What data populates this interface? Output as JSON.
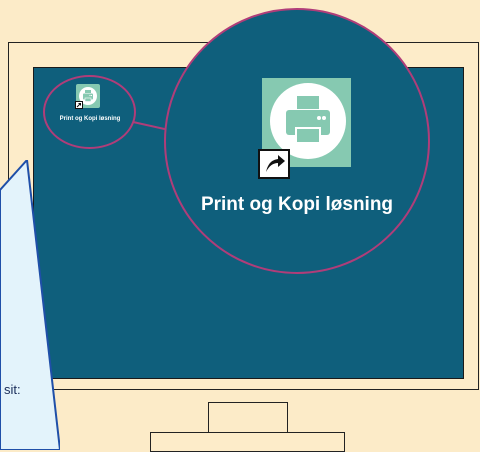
{
  "desktop": {
    "shortcut_label": "Print og Kopi løsning",
    "icon": "printer-shortcut-icon"
  },
  "zoom": {
    "label": "Print og Kopi løsning",
    "icon": "printer-shortcut-icon"
  },
  "callout": {
    "partial_text": "sit:"
  },
  "colors": {
    "background": "#fcebc8",
    "screen": "#0f5f7c",
    "icon_tile": "#86c9b1",
    "highlight_ring": "#b03d79",
    "callout_fill": "#e3f3fb",
    "callout_border": "#1f4fa8"
  }
}
